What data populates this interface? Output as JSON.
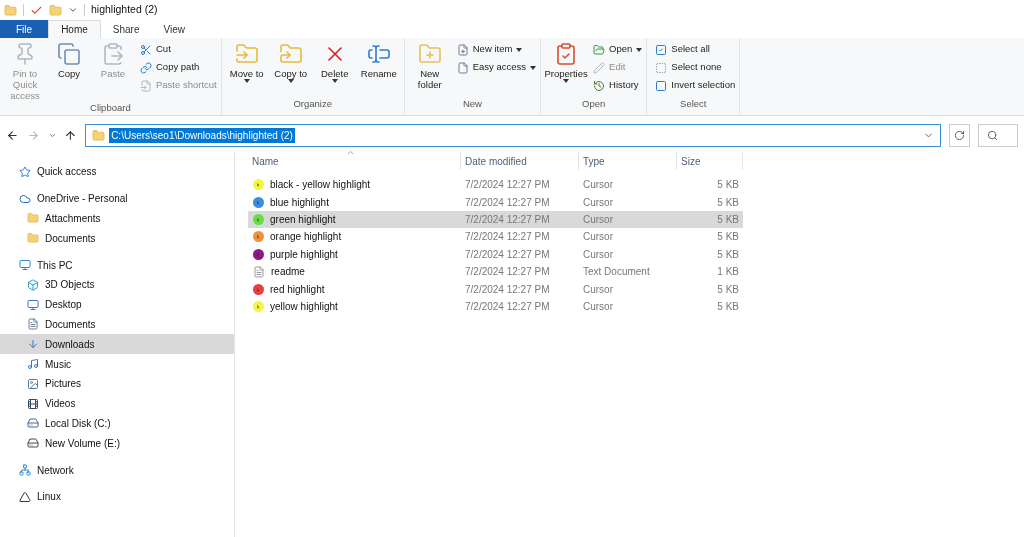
{
  "window": {
    "title": "highlighted (2)"
  },
  "tabs": [
    {
      "label": "File",
      "kind": "file",
      "selected": false
    },
    {
      "label": "Home",
      "kind": "tab",
      "selected": true
    },
    {
      "label": "Share",
      "kind": "tab",
      "selected": false
    },
    {
      "label": "View",
      "kind": "tab",
      "selected": false
    }
  ],
  "ribbon": [
    {
      "name": "Clipboard",
      "large": [
        {
          "label": "Pin to Quick access",
          "disabled": true,
          "dropdown": false
        },
        {
          "label": "Copy",
          "disabled": false,
          "dropdown": false
        },
        {
          "label": "Paste",
          "disabled": true,
          "dropdown": false
        }
      ],
      "small": [
        {
          "label": "Cut",
          "disabled": false,
          "dropdown": false
        },
        {
          "label": "Copy path",
          "disabled": false,
          "dropdown": false
        },
        {
          "label": "Paste shortcut",
          "disabled": true,
          "dropdown": false
        }
      ]
    },
    {
      "name": "Organize",
      "large": [
        {
          "label": "Move to",
          "disabled": false,
          "dropdown": true
        },
        {
          "label": "Copy to",
          "disabled": false,
          "dropdown": true
        },
        {
          "label": "Delete",
          "disabled": false,
          "dropdown": true
        },
        {
          "label": "Rename",
          "disabled": false,
          "dropdown": false
        }
      ]
    },
    {
      "name": "New",
      "large": [
        {
          "label": "New folder",
          "disabled": false,
          "dropdown": false
        }
      ],
      "small": [
        {
          "label": "New item",
          "disabled": false,
          "dropdown": true
        },
        {
          "label": "Easy access",
          "disabled": false,
          "dropdown": true
        }
      ]
    },
    {
      "name": "Open",
      "large": [
        {
          "label": "Properties",
          "disabled": false,
          "dropdown": true
        }
      ],
      "small": [
        {
          "label": "Open",
          "disabled": false,
          "dropdown": true
        },
        {
          "label": "Edit",
          "disabled": true,
          "dropdown": false
        },
        {
          "label": "History",
          "disabled": false,
          "dropdown": false
        }
      ]
    },
    {
      "name": "Select",
      "small": [
        {
          "label": "Select all",
          "disabled": false,
          "dropdown": false
        },
        {
          "label": "Select none",
          "disabled": false,
          "dropdown": false
        },
        {
          "label": "Invert selection",
          "disabled": false,
          "dropdown": false
        }
      ]
    }
  ],
  "address": {
    "path": "C:\\Users\\seo1\\Downloads\\highlighted (2)",
    "selected": true
  },
  "sidebar": {
    "items": [
      {
        "label": "Quick access",
        "kind": "quick",
        "selected": false
      },
      {
        "label": "OneDrive - Personal",
        "kind": "cloud",
        "selected": false,
        "children": [
          {
            "label": "Attachments",
            "kind": "folder",
            "selected": false
          },
          {
            "label": "Documents",
            "kind": "folder",
            "selected": false
          }
        ]
      },
      {
        "label": "This PC",
        "kind": "pc",
        "selected": false,
        "children": [
          {
            "label": "3D Objects",
            "kind": "cube",
            "selected": false
          },
          {
            "label": "Desktop",
            "kind": "desktop",
            "selected": false
          },
          {
            "label": "Documents",
            "kind": "doc",
            "selected": false
          },
          {
            "label": "Downloads",
            "kind": "download",
            "selected": true
          },
          {
            "label": "Music",
            "kind": "music",
            "selected": false
          },
          {
            "label": "Pictures",
            "kind": "picture",
            "selected": false
          },
          {
            "label": "Videos",
            "kind": "video",
            "selected": false
          },
          {
            "label": "Local Disk (C:)",
            "kind": "disk",
            "selected": false
          },
          {
            "label": "New Volume (E:)",
            "kind": "drive",
            "selected": false
          }
        ]
      },
      {
        "label": "Network",
        "kind": "network",
        "selected": false
      },
      {
        "label": "Linux",
        "kind": "linux",
        "selected": false
      }
    ]
  },
  "table": {
    "columns": [
      "Name",
      "Date modified",
      "Type",
      "Size"
    ],
    "rows": [
      {
        "name": "black - yellow highlight",
        "date": "7/2/2024 12:27 PM",
        "type": "Cursor",
        "size": "5 KB",
        "kind": "cursor",
        "color": "#f5f542",
        "selected": false
      },
      {
        "name": "blue highlight",
        "date": "7/2/2024 12:27 PM",
        "type": "Cursor",
        "size": "5 KB",
        "kind": "cursor",
        "color": "#3a8ee0",
        "selected": false
      },
      {
        "name": "green highlight",
        "date": "7/2/2024 12:27 PM",
        "type": "Cursor",
        "size": "5 KB",
        "kind": "cursor",
        "color": "#66dd44",
        "selected": true
      },
      {
        "name": "orange highlight",
        "date": "7/2/2024 12:27 PM",
        "type": "Cursor",
        "size": "5 KB",
        "kind": "cursor",
        "color": "#f0903a",
        "selected": false
      },
      {
        "name": "purple highlight",
        "date": "7/2/2024 12:27 PM",
        "type": "Cursor",
        "size": "5 KB",
        "kind": "cursor",
        "color": "#8a1a8a",
        "selected": false
      },
      {
        "name": "readme",
        "date": "7/2/2024 12:27 PM",
        "type": "Text Document",
        "size": "1 KB",
        "kind": "text",
        "selected": false
      },
      {
        "name": "red highlight",
        "date": "7/2/2024 12:27 PM",
        "type": "Cursor",
        "size": "5 KB",
        "kind": "cursor",
        "color": "#e84040",
        "selected": false
      },
      {
        "name": "yellow highlight",
        "date": "7/2/2024 12:27 PM",
        "type": "Cursor",
        "size": "5 KB",
        "kind": "cursor",
        "color": "#f5f542",
        "selected": false
      }
    ]
  }
}
